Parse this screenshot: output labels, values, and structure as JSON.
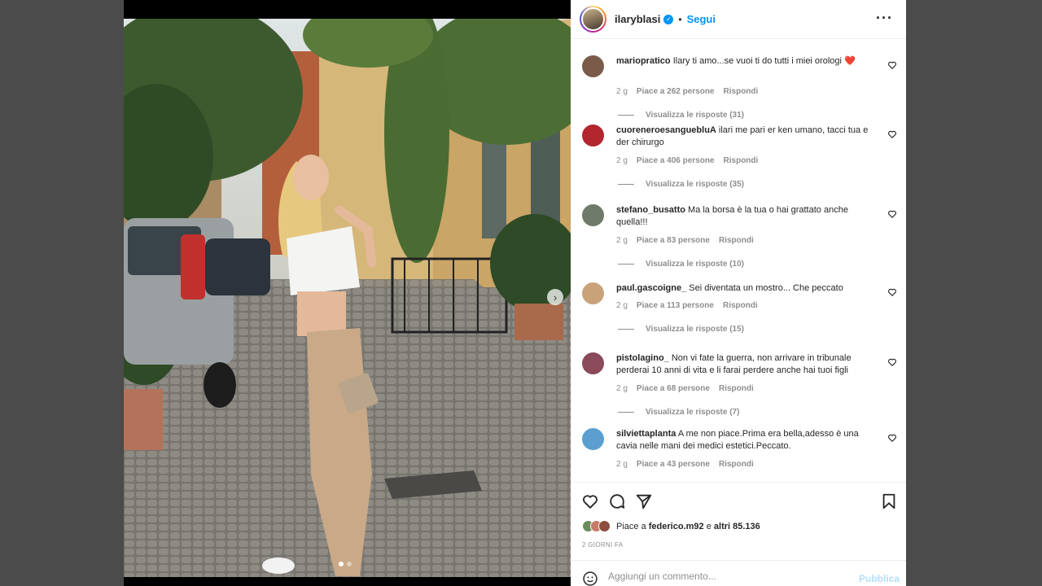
{
  "post": {
    "author": "ilaryblasi",
    "separator": "•",
    "follow_label": "Segui",
    "more_label": "···",
    "verified_glyph": "✓"
  },
  "media": {
    "next_glyph": "›",
    "slide_count": 2,
    "active_slide": 1
  },
  "comments": [
    {
      "user": "mariopratico",
      "text": "Ilary ti amo...se vuoi ti do tutti i miei orologi ❤️",
      "age": "2 g",
      "likes": "Piace a 262 persone",
      "reply": "Rispondi",
      "view_replies": "Visualizza le risposte (31)",
      "avatar_color": "#7a5a48"
    },
    {
      "user": "cuoreneroesanguebluA",
      "text": "ilari me pari er ken umano, tacci tua e der chirurgo",
      "age": "2 g",
      "likes": "Piace a 406 persone",
      "reply": "Rispondi",
      "view_replies": "Visualizza le risposte (35)",
      "avatar_color": "#b3262e"
    },
    {
      "user": "stefano_busatto",
      "text": "Ma la borsa è la tua o hai grattato anche quella!!!",
      "age": "2 g",
      "likes": "Piace a 83 persone",
      "reply": "Rispondi",
      "view_replies": "Visualizza le risposte (10)",
      "avatar_color": "#6f7a6a"
    },
    {
      "user": "paul.gascoigne_",
      "text": "Sei diventata un mostro... Che peccato",
      "age": "2 g",
      "likes": "Piace a 113 persone",
      "reply": "Rispondi",
      "view_replies": "Visualizza le risposte (15)",
      "avatar_color": "#c9a27a"
    },
    {
      "user": "pistolagino_",
      "text": "Non vi fate la guerra, non arrivare in tribunale perderai 10 anni di vita e li farai perdere anche hai tuoi figli",
      "age": "2 g",
      "likes": "Piace a 68 persone",
      "reply": "Rispondi",
      "view_replies": "Visualizza le risposte (7)",
      "avatar_color": "#8a4a5a"
    },
    {
      "user": "silviettaplanta",
      "text": "A me non piace.Prima era bella,adesso è una cavia nelle mani dei medici estetici.Peccato.",
      "age": "2 g",
      "likes": "Piace a 43 persone",
      "reply": "Rispondi",
      "view_replies": "",
      "avatar_color": "#5a9fd0"
    }
  ],
  "actions": {
    "like_icon": "heart-outline-icon",
    "comment_icon": "speech-bubble-icon",
    "share_icon": "paper-plane-icon",
    "save_icon": "bookmark-icon"
  },
  "likes_summary": {
    "prefix": "Piace a",
    "user": "federico.m92",
    "connector": "e",
    "others": "altri 85.136"
  },
  "date": "2 GIORNI FA",
  "add_comment": {
    "placeholder": "Aggiungi un commento...",
    "publish_label": "Pubblica"
  },
  "colors": {
    "accent": "#0095f6",
    "heart_red": "#ed4956",
    "muted": "#8e8e8e",
    "publish_disabled": "#b2dffc"
  }
}
